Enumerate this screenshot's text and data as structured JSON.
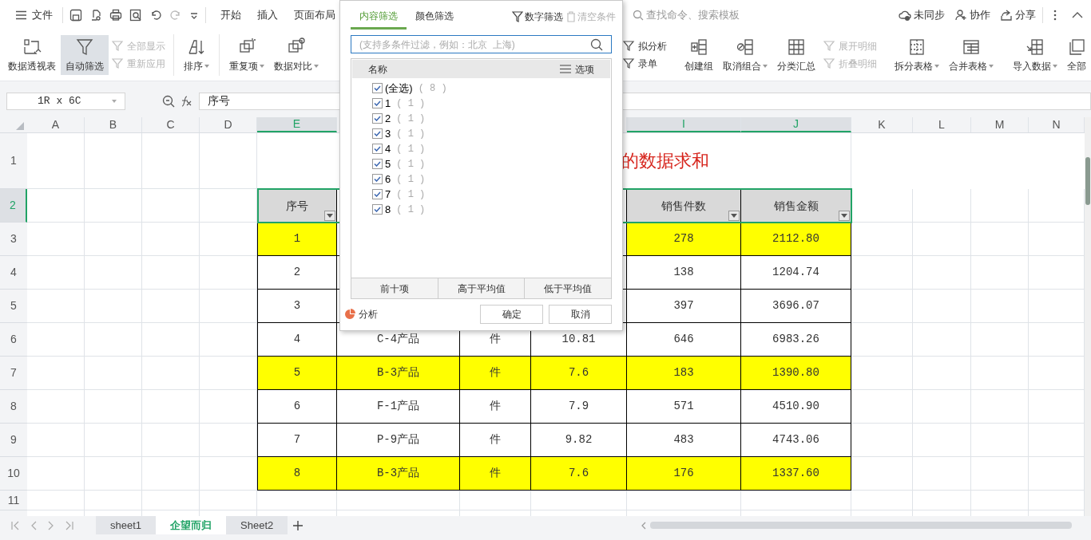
{
  "top_bar": {
    "file_menu": "文件",
    "tabs": [
      {
        "label": "开始"
      },
      {
        "label": "插入"
      },
      {
        "label": "页面布局"
      }
    ],
    "search": {
      "placeholder": "查找命令、搜索模板"
    },
    "actions": [
      "未同步",
      "协作",
      "分享"
    ]
  },
  "ribbon": {
    "left": [
      {
        "kind": "large",
        "label": "数据透视表",
        "dropdown": false,
        "active": false
      },
      {
        "kind": "large",
        "label": "自动筛选",
        "dropdown": false,
        "active": true
      },
      {
        "kind": "pair",
        "items": [
          {
            "label": "全部显示",
            "disabled": true
          },
          {
            "label": "重新应用",
            "disabled": true
          }
        ]
      },
      {
        "kind": "divider"
      },
      {
        "kind": "large",
        "label": "排序",
        "dropdown": true,
        "active": false
      },
      {
        "kind": "divider"
      },
      {
        "kind": "large",
        "label": "重复项",
        "dropdown": true,
        "active": false
      },
      {
        "kind": "large",
        "label": "数据对比",
        "dropdown": true,
        "active": false
      }
    ],
    "right": [
      {
        "kind": "pair",
        "items": [
          {
            "label": "拟分析",
            "disabled": false
          },
          {
            "label": "录单",
            "disabled": false
          }
        ]
      },
      {
        "kind": "divider"
      },
      {
        "kind": "large",
        "label": "创建组",
        "dropdown": false,
        "active": false
      },
      {
        "kind": "large",
        "label": "取消组合",
        "dropdown": true,
        "active": false
      },
      {
        "kind": "large",
        "label": "分类汇总",
        "dropdown": false,
        "active": false
      },
      {
        "kind": "pair",
        "items": [
          {
            "label": "展开明细",
            "disabled": true
          },
          {
            "label": "折叠明细",
            "disabled": true
          }
        ]
      },
      {
        "kind": "divider"
      },
      {
        "kind": "large",
        "label": "拆分表格",
        "dropdown": true,
        "active": false
      },
      {
        "kind": "large",
        "label": "合并表格",
        "dropdown": true,
        "active": false
      },
      {
        "kind": "divider"
      },
      {
        "kind": "large",
        "label": "导入数据",
        "dropdown": true,
        "active": false
      },
      {
        "kind": "large",
        "label": "全部",
        "dropdown": false,
        "active": false
      }
    ]
  },
  "formula_bar": {
    "name_box": "1R x 6C",
    "formula": "序号"
  },
  "sheet": {
    "columns": [
      {
        "label": "A",
        "selected": false
      },
      {
        "label": "B",
        "selected": false
      },
      {
        "label": "C",
        "selected": false
      },
      {
        "label": "D",
        "selected": false
      },
      {
        "label": "E",
        "selected": true
      },
      {},
      {},
      {},
      {
        "label": "I",
        "selected": true
      },
      {
        "label": "J",
        "selected": true
      },
      {
        "label": "K",
        "selected": false
      },
      {
        "label": "L",
        "selected": false
      },
      {
        "label": "M",
        "selected": false
      },
      {
        "label": "N",
        "selected": false
      }
    ],
    "rows": [
      {
        "number": "1",
        "selected": false,
        "title": "的数据求和"
      },
      {
        "number": "2",
        "selected": true,
        "header": {
          "left": [
            {
              "text": "序号",
              "filter": true
            }
          ],
          "right": [
            {
              "text": "销售件数",
              "filter": true
            },
            {
              "text": "销售金额",
              "filter": true
            }
          ]
        }
      },
      {
        "number": "3",
        "selected": false,
        "highlight": true,
        "cells": [
          {
            "text": "1"
          },
          {},
          {},
          {},
          {
            "text": "278"
          },
          {
            "text": "2112.80"
          }
        ]
      },
      {
        "number": "4",
        "selected": false,
        "highlight": false,
        "cells": [
          {
            "text": "2"
          },
          {},
          {},
          {},
          {
            "text": "138"
          },
          {
            "text": "1204.74"
          }
        ]
      },
      {
        "number": "5",
        "selected": false,
        "highlight": false,
        "cells": [
          {
            "text": "3"
          },
          {},
          {},
          {},
          {
            "text": "397"
          },
          {
            "text": "3696.07"
          }
        ]
      },
      {
        "number": "6",
        "selected": false,
        "highlight": false,
        "cells": [
          {
            "text": "4"
          },
          {
            "text": "C-4产品"
          },
          {
            "text": "件"
          },
          {
            "text": "10.81"
          },
          {
            "text": "646"
          },
          {
            "text": "6983.26"
          }
        ]
      },
      {
        "number": "7",
        "selected": false,
        "highlight": true,
        "cells": [
          {
            "text": "5"
          },
          {
            "text": "B-3产品"
          },
          {
            "text": "件"
          },
          {
            "text": "7.6"
          },
          {
            "text": "183"
          },
          {
            "text": "1390.80"
          }
        ]
      },
      {
        "number": "8",
        "selected": false,
        "highlight": false,
        "cells": [
          {
            "text": "6"
          },
          {
            "text": "F-1产品"
          },
          {
            "text": "件"
          },
          {
            "text": "7.9"
          },
          {
            "text": "571"
          },
          {
            "text": "4510.90"
          }
        ]
      },
      {
        "number": "9",
        "selected": false,
        "highlight": false,
        "cells": [
          {
            "text": "7"
          },
          {
            "text": "P-9产品"
          },
          {
            "text": "件"
          },
          {
            "text": "9.82"
          },
          {
            "text": "483"
          },
          {
            "text": "4743.06"
          }
        ]
      },
      {
        "number": "10",
        "selected": false,
        "highlight": true,
        "cells": [
          {
            "text": "8"
          },
          {
            "text": "B-3产品"
          },
          {
            "text": "件"
          },
          {
            "text": "7.6"
          },
          {
            "text": "176"
          },
          {
            "text": "1337.60"
          }
        ]
      },
      {
        "number": "11",
        "selected": false
      }
    ]
  },
  "filter_popup": {
    "tabs": [
      {
        "label": "内容筛选",
        "selected": true
      },
      {
        "label": "颜色筛选",
        "selected": false
      }
    ],
    "actions": [
      {
        "label": "数字筛选",
        "disabled": false
      },
      {
        "label": "清空条件",
        "disabled": true
      }
    ],
    "search": {
      "placeholder": "(支持多条件过滤，例如：北京  上海)"
    },
    "list_header": {
      "name": "名称",
      "options": "选项"
    },
    "items": [
      {
        "label": "(全选)",
        "count": "( 8 )",
        "checked": true
      },
      {
        "label": "1",
        "count": "( 1 )",
        "checked": true
      },
      {
        "label": "2",
        "count": "( 1 )",
        "checked": true
      },
      {
        "label": "3",
        "count": "( 1 )",
        "checked": true
      },
      {
        "label": "4",
        "count": "( 1 )",
        "checked": true
      },
      {
        "label": "5",
        "count": "( 1 )",
        "checked": true
      },
      {
        "label": "6",
        "count": "( 1 )",
        "checked": true
      },
      {
        "label": "7",
        "count": "( 1 )",
        "checked": true
      },
      {
        "label": "8",
        "count": "( 1 )",
        "checked": true
      }
    ],
    "quick_buttons": [
      "前十项",
      "高于平均值",
      "低于平均值"
    ],
    "analyze": "分析",
    "ok": "确定",
    "cancel": "取消"
  },
  "sheet_tabs": [
    {
      "label": "sheet1",
      "selected": false
    },
    {
      "label": "企望而归",
      "selected": true
    },
    {
      "label": "Sheet2",
      "selected": false
    }
  ]
}
